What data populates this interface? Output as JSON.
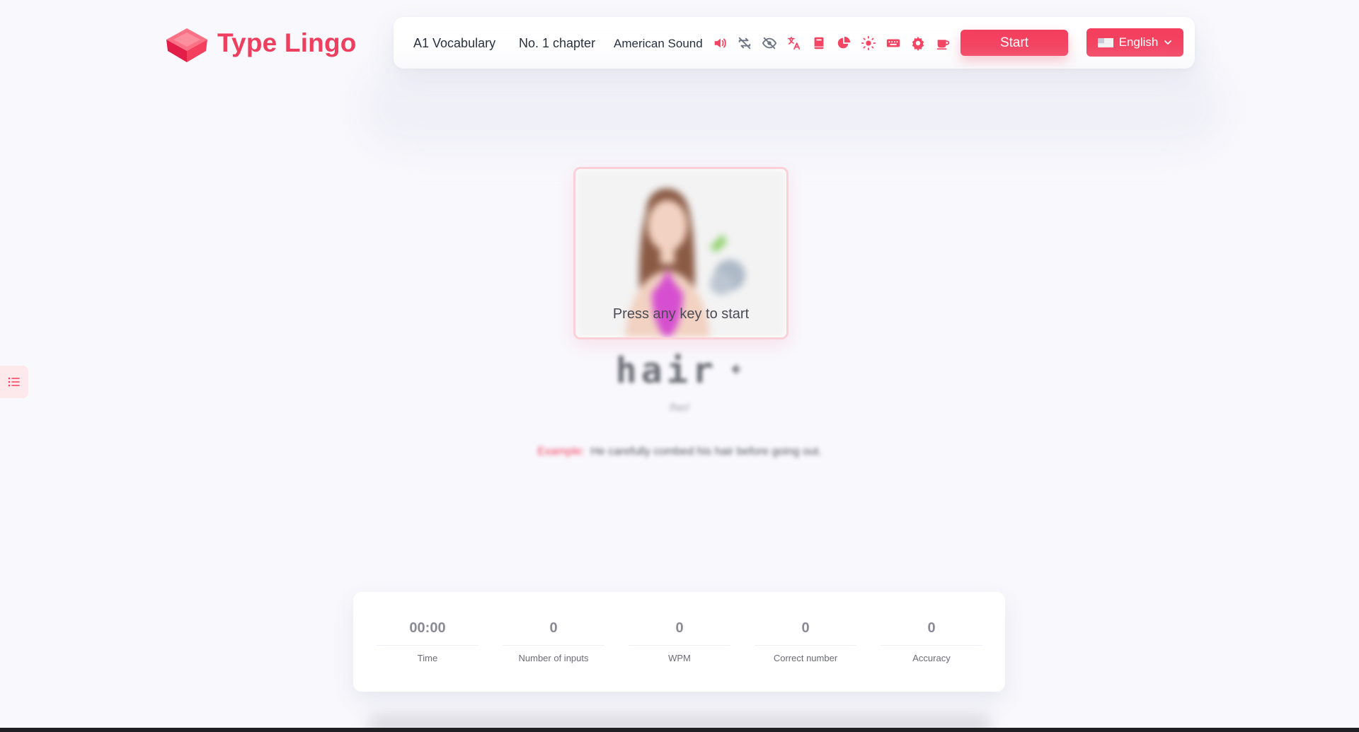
{
  "app": {
    "title": "Type Lingo",
    "brand_color": "#f43f5e"
  },
  "toolbar": {
    "dictionary": "A1 Vocabulary",
    "chapter": "No. 1 chapter",
    "pronunciation": "American Sound",
    "icons": [
      "speaker-icon",
      "loop-off-icon",
      "eye-slash-icon",
      "translate-icon",
      "book-icon",
      "chart-pie-icon",
      "sun-icon",
      "keyboard-icon",
      "settings-icon",
      "coffee-icon"
    ],
    "start_label": "Start",
    "language_label": "English"
  },
  "practice": {
    "press_hint": "Press any key to start",
    "word": "hair",
    "phonetic": "/hɛr/",
    "example_label": "Example:",
    "example_text": "He carefully combed his hair before going out."
  },
  "stats": [
    {
      "value": "00:00",
      "label": "Time"
    },
    {
      "value": "0",
      "label": "Number of inputs"
    },
    {
      "value": "0",
      "label": "WPM"
    },
    {
      "value": "0",
      "label": "Correct number"
    },
    {
      "value": "0",
      "label": "Accuracy"
    }
  ]
}
